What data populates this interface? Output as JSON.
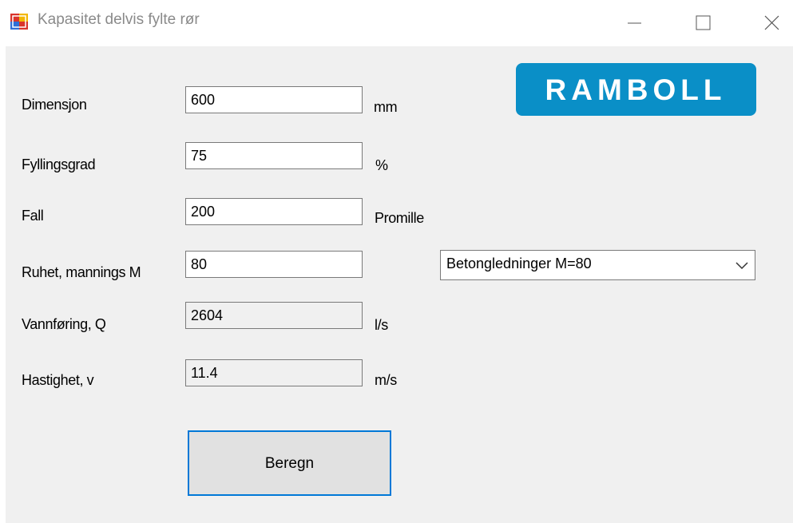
{
  "window": {
    "title": "Kapasitet delvis fylte rør",
    "icon": "app-icon",
    "controls": [
      "minimize-icon",
      "maximize-icon",
      "close-icon"
    ]
  },
  "logo": {
    "text": "RAMBOLL",
    "color": "#0a8fc7"
  },
  "fields": {
    "dimensjon": {
      "label": "Dimensjon",
      "value": "600",
      "unit": "mm"
    },
    "fyllingsgrad": {
      "label": "Fyllingsgrad",
      "value": "75",
      "unit": "%"
    },
    "fall": {
      "label": "Fall",
      "value": "200",
      "unit": "Promille"
    },
    "ruhet": {
      "label": "Ruhet, mannings M",
      "value": "80"
    },
    "vannforing": {
      "label": "Vannføring, Q",
      "value": "2604",
      "unit": "l/s"
    },
    "hastighet": {
      "label": "Hastighet, v",
      "value": "11.4",
      "unit": "m/s"
    }
  },
  "material_select": {
    "selected": "Betongledninger M=80"
  },
  "calc_button": {
    "label": "Beregn",
    "accent": "#0078d7"
  }
}
